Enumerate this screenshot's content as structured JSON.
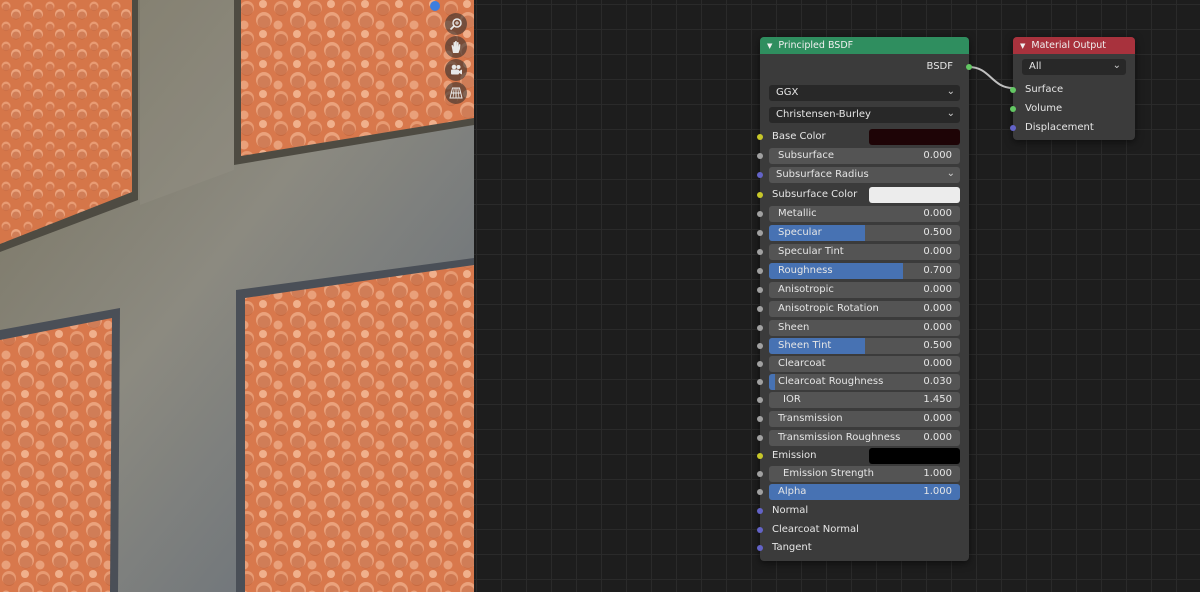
{
  "viewport": {
    "nav_icons": [
      "zoom-icon",
      "hand-pan-icon",
      "camera-icon",
      "perspective-grid-icon"
    ],
    "colors": {
      "wall": "#6e6a5e",
      "tile": "#d87a4e",
      "gizmo": "#3d7ede"
    }
  },
  "principled_bsdf": {
    "title": "Principled BSDF",
    "output_socket": "BSDF",
    "distribution": "GGX",
    "subsurface_method": "Christensen-Burley",
    "inputs": [
      {
        "key": "base_color",
        "label": "Base Color",
        "type": "color",
        "socket": "yellow",
        "color": "#1e0406"
      },
      {
        "key": "subsurface",
        "label": "Subsurface",
        "type": "value",
        "socket": "gray",
        "value": "0.000",
        "factor": 0
      },
      {
        "key": "subsurface_radius",
        "label": "Subsurface Radius",
        "type": "dropdown",
        "socket": "purple"
      },
      {
        "key": "subsurface_color",
        "label": "Subsurface Color",
        "type": "color",
        "socket": "yellow",
        "color": "#ececec"
      },
      {
        "key": "metallic",
        "label": "Metallic",
        "type": "value",
        "socket": "gray",
        "value": "0.000",
        "factor": 0
      },
      {
        "key": "specular",
        "label": "Specular",
        "type": "value",
        "socket": "gray",
        "value": "0.500",
        "factor": 0.5
      },
      {
        "key": "specular_tint",
        "label": "Specular Tint",
        "type": "value",
        "socket": "gray",
        "value": "0.000",
        "factor": 0
      },
      {
        "key": "roughness",
        "label": "Roughness",
        "type": "value",
        "socket": "gray",
        "value": "0.700",
        "factor": 0.7
      },
      {
        "key": "anisotropic",
        "label": "Anisotropic",
        "type": "value",
        "socket": "gray",
        "value": "0.000",
        "factor": 0
      },
      {
        "key": "anisotropic_rotation",
        "label": "Anisotropic Rotation",
        "type": "value",
        "socket": "gray",
        "value": "0.000",
        "factor": 0
      },
      {
        "key": "sheen",
        "label": "Sheen",
        "type": "value",
        "socket": "gray",
        "value": "0.000",
        "factor": 0
      },
      {
        "key": "sheen_tint",
        "label": "Sheen Tint",
        "type": "value",
        "socket": "gray",
        "value": "0.500",
        "factor": 0.5
      },
      {
        "key": "clearcoat",
        "label": "Clearcoat",
        "type": "value",
        "socket": "gray",
        "value": "0.000",
        "factor": 0
      },
      {
        "key": "clearcoat_roughness",
        "label": "Clearcoat Roughness",
        "type": "value",
        "socket": "gray",
        "value": "0.030",
        "factor": 0.03
      },
      {
        "key": "ior",
        "label": "IOR",
        "type": "number",
        "socket": "gray",
        "value": "1.450"
      },
      {
        "key": "transmission",
        "label": "Transmission",
        "type": "value",
        "socket": "gray",
        "value": "0.000",
        "factor": 0
      },
      {
        "key": "transmission_roughness",
        "label": "Transmission Roughness",
        "type": "value",
        "socket": "gray",
        "value": "0.000",
        "factor": 0
      },
      {
        "key": "emission",
        "label": "Emission",
        "type": "color",
        "socket": "yellow",
        "color": "#000000"
      },
      {
        "key": "emission_strength",
        "label": "Emission Strength",
        "type": "number",
        "socket": "gray",
        "value": "1.000"
      },
      {
        "key": "alpha",
        "label": "Alpha",
        "type": "value",
        "socket": "gray",
        "value": "1.000",
        "factor": 1
      },
      {
        "key": "normal",
        "label": "Normal",
        "type": "socket",
        "socket": "purple"
      },
      {
        "key": "clearcoat_normal",
        "label": "Clearcoat Normal",
        "type": "socket",
        "socket": "purple"
      },
      {
        "key": "tangent",
        "label": "Tangent",
        "type": "socket",
        "socket": "purple"
      }
    ]
  },
  "material_output": {
    "title": "Material Output",
    "target": "All",
    "inputs": [
      {
        "key": "surface",
        "label": "Surface",
        "socket": "green"
      },
      {
        "key": "volume",
        "label": "Volume",
        "socket": "green"
      },
      {
        "key": "displacement",
        "label": "Displacement",
        "socket": "purple"
      }
    ]
  },
  "colors": {
    "bsdf_header": "#2f8e5f",
    "output_header": "#a8323d",
    "slider_fill": "#4772b3",
    "link": "#c0c0c0"
  }
}
